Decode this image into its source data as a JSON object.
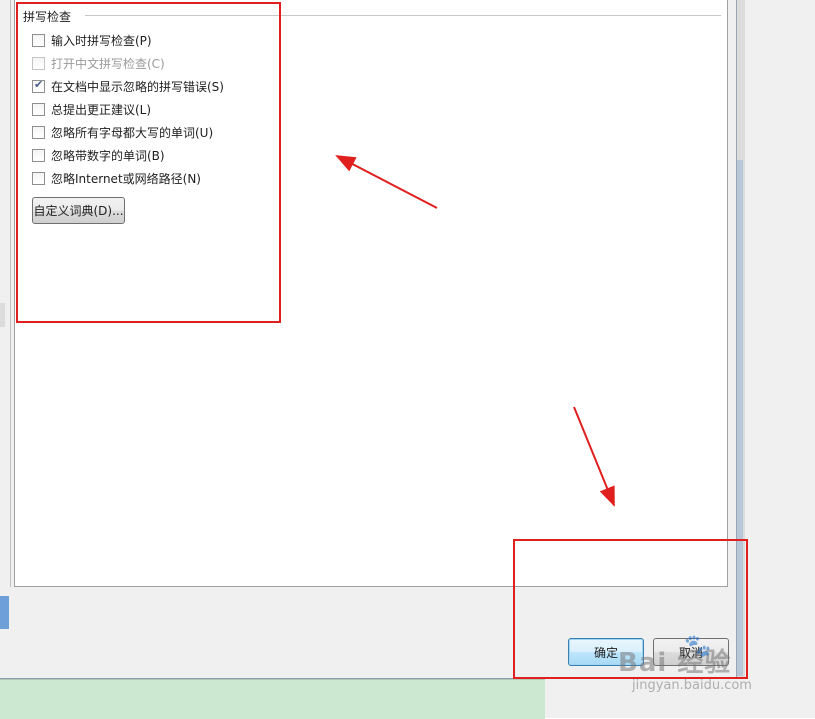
{
  "section": {
    "title": "拼写检查"
  },
  "options": [
    {
      "label": "输入时拼写检查(P)",
      "checked": false,
      "disabled": false
    },
    {
      "label": "打开中文拼写检查(C)",
      "checked": false,
      "disabled": true
    },
    {
      "label": "在文档中显示忽略的拼写错误(S)",
      "checked": true,
      "disabled": false
    },
    {
      "label": "总提出更正建议(L)",
      "checked": false,
      "disabled": false
    },
    {
      "label": "忽略所有字母都大写的单词(U)",
      "checked": false,
      "disabled": false
    },
    {
      "label": "忽略带数字的单词(B)",
      "checked": false,
      "disabled": false
    },
    {
      "label": "忽略Internet或网络路径(N)",
      "checked": false,
      "disabled": false
    }
  ],
  "buttons": {
    "custom_dict": "自定义词典(D)...",
    "ok": "确定",
    "cancel": "取消"
  },
  "watermark": {
    "main": "Bai 经验",
    "sub": "jingyan.baidu.com",
    "paw": "🐾"
  },
  "colors": {
    "annotation": "#e0201e",
    "ok_border": "#3c7fb1"
  }
}
